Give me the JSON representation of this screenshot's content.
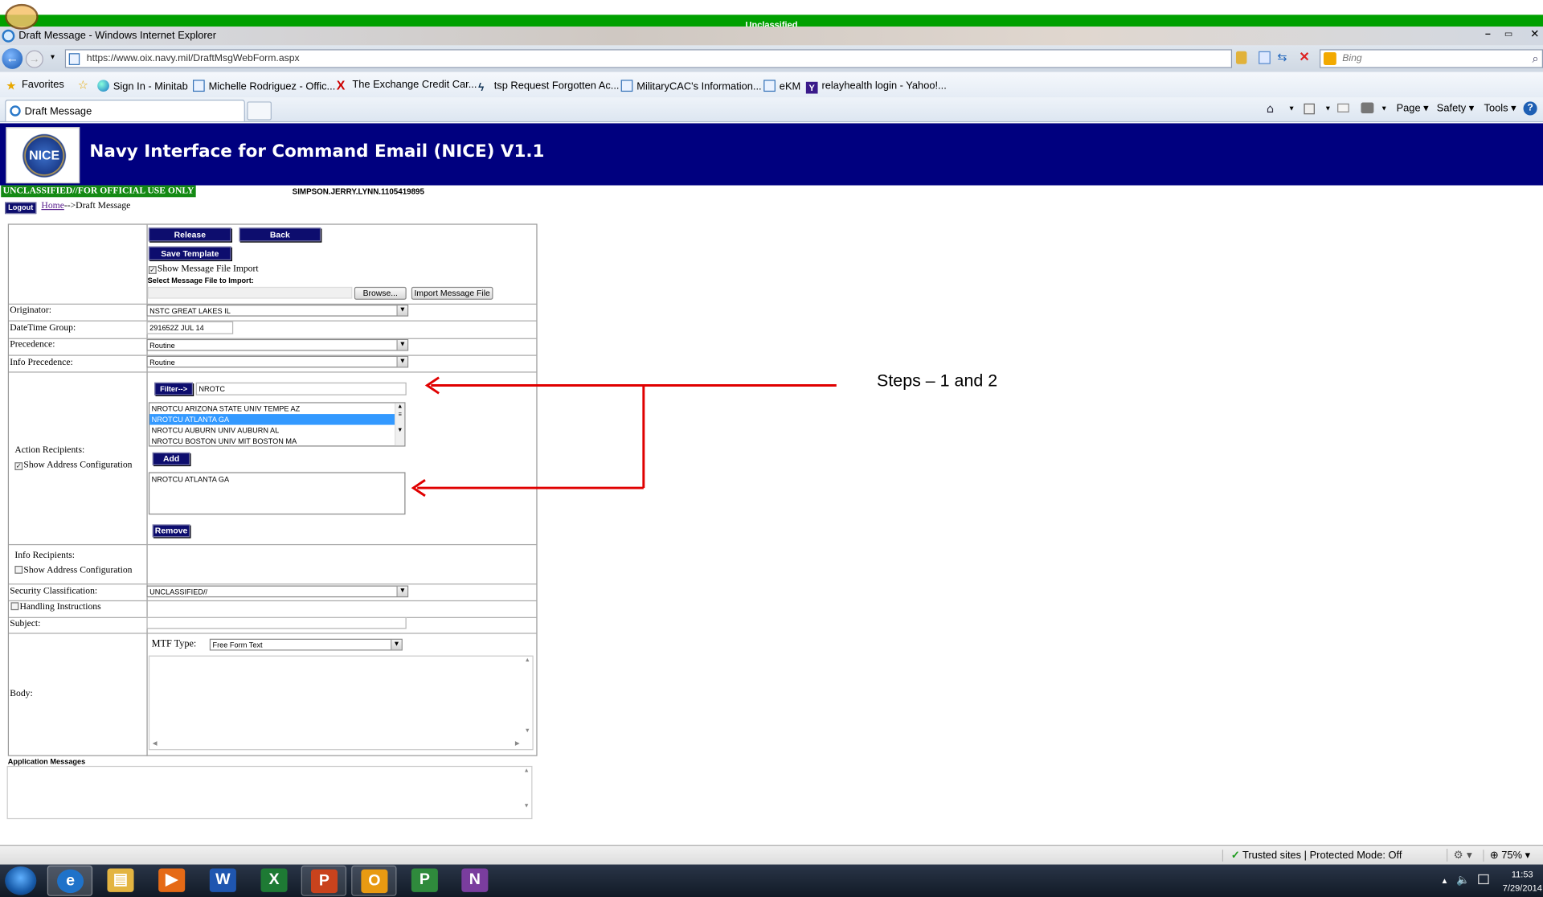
{
  "top_banner": {
    "text": "Unclassified",
    "color": "#00a000"
  },
  "browser": {
    "window_title": "Draft Message - Windows Internet Explorer",
    "address": "https://www.oix.navy.mil/DraftMsgWebForm.aspx",
    "search_placeholder": "Bing",
    "tab_label": "Draft Message",
    "favorites_label": "Favorites",
    "favorites": [
      {
        "label": "Sign In - Minitab",
        "icon": "globe-icon"
      },
      {
        "label": "Michelle Rodriguez - Offic...",
        "icon": "ie-page-icon"
      },
      {
        "label": "The Exchange  Credit Car...",
        "icon": "exchange-x-icon"
      },
      {
        "label": "tsp Request Forgotten Ac...",
        "icon": "tsp-icon"
      },
      {
        "label": "MilitaryCAC's Information...",
        "icon": "ie-page-icon"
      },
      {
        "label": "eKM",
        "icon": "ie-page-icon"
      },
      {
        "label": "relayhealth login - Yahoo!...",
        "icon": "yahoo-icon"
      }
    ],
    "command_bar": {
      "page": "Page",
      "safety": "Safety",
      "tools": "Tools"
    }
  },
  "app": {
    "logo_text": "NICE",
    "title": "Navy Interface for Command Email (NICE) V1.1",
    "header_color": "#00007f",
    "classification": "UNCLASSIFIED//FOR OFFICIAL USE ONLY",
    "user": "SIMPSON.JERRY.LYNN.1105419895",
    "logout": "Logout",
    "breadcrumb_home": "Home",
    "breadcrumb_rest": "-->Draft Message"
  },
  "form": {
    "release": "Release",
    "back": "Back",
    "save_template": "Save Template",
    "show_import_label": "Show Message File Import",
    "show_import_checked": true,
    "select_file_label": "Select Message File to Import:",
    "browse": "Browse...",
    "import_button": "Import Message File",
    "originator_label": "Originator:",
    "originator_value": "NSTC GREAT LAKES IL",
    "dtg_label": "DateTime Group:",
    "dtg_value": "291652Z JUL 14",
    "precedence_label": "Precedence:",
    "precedence_value": "Routine",
    "info_precedence_label": "Info Precedence:",
    "info_precedence_value": "Routine",
    "action_recipients_label": "Action Recipients:",
    "show_address_config": "Show Address Configuration",
    "action_show_checked": true,
    "filter_button": "Filter-->",
    "filter_value": "NROTC",
    "list_options": [
      "NROTCU ARIZONA STATE UNIV TEMPE AZ",
      "NROTCU ATLANTA GA",
      "NROTCU AUBURN UNIV AUBURN AL",
      "NROTCU BOSTON UNIV MIT BOSTON MA"
    ],
    "selected_option_index": 1,
    "add_button": "Add",
    "selected_recipient": "NROTCU ATLANTA GA",
    "remove_button": "Remove",
    "info_recipients_label": "Info Recipients:",
    "info_show_checked": false,
    "security_label": "Security Classification:",
    "security_value": "UNCLASSIFIED//",
    "handling_label": "Handling Instructions",
    "subject_label": "Subject:",
    "body_label": "Body:",
    "mtf_label": "MTF Type:",
    "mtf_value": "Free Form Text",
    "app_messages_label": "Application Messages"
  },
  "annotation": {
    "text": "Steps – 1 and 2",
    "color": "#e00000"
  },
  "status_bar": {
    "zone": "Trusted sites | Protected Mode: Off",
    "zoom": "75%"
  },
  "taskbar": {
    "apps": [
      "internet-explorer-icon",
      "file-explorer-icon",
      "media-player-icon",
      "word-icon",
      "excel-icon",
      "powerpoint-icon",
      "outlook-icon",
      "project-icon",
      "onenote-icon"
    ],
    "time": "11:53",
    "date": "7/29/2014"
  }
}
